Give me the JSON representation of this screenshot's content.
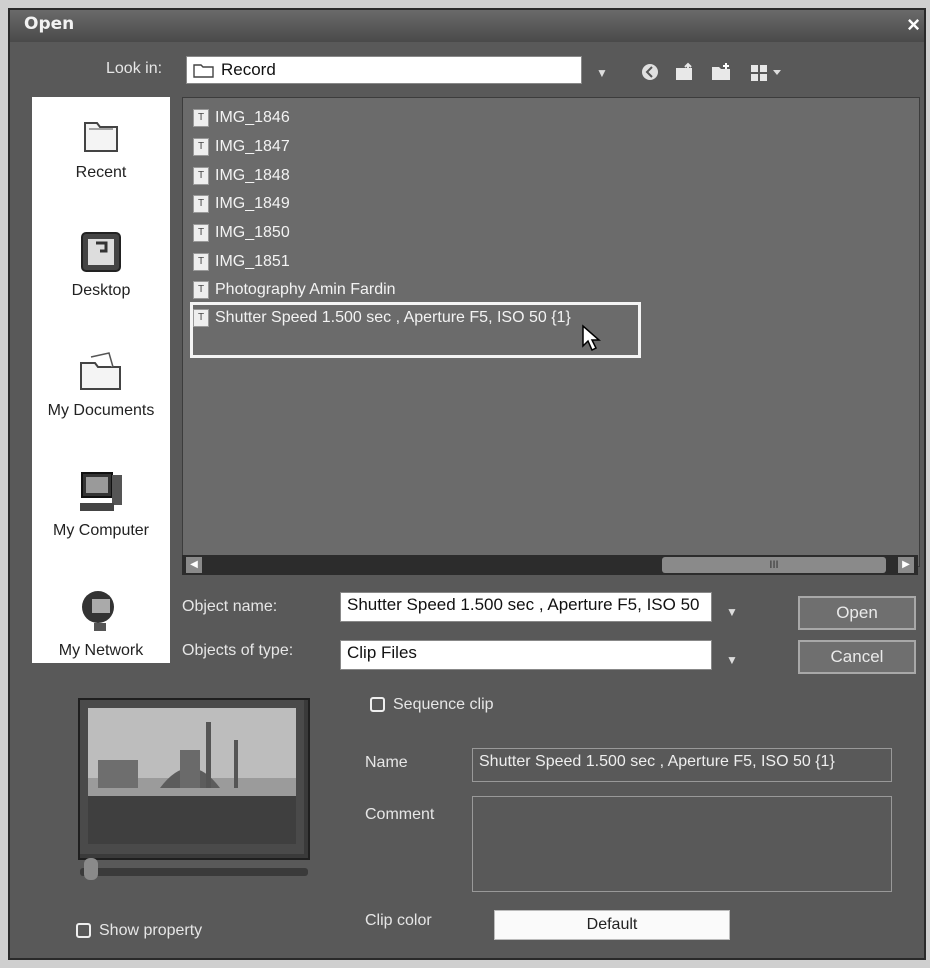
{
  "dialog": {
    "title": "Open",
    "close_glyph": "×"
  },
  "toolbar": {
    "look_in_label": "Look in:",
    "look_in_value": "Record",
    "icons": [
      "back-icon",
      "up-folder-icon",
      "new-folder-icon",
      "view-menu-icon"
    ]
  },
  "places": [
    {
      "label": "Recent",
      "icon": "recent-icon"
    },
    {
      "label": "Desktop",
      "icon": "desktop-icon"
    },
    {
      "label": "My Documents",
      "icon": "my-documents-icon"
    },
    {
      "label": "My Computer",
      "icon": "my-computer-icon"
    },
    {
      "label": "My Network",
      "icon": "my-network-icon"
    }
  ],
  "files": [
    "IMG_1846",
    "IMG_1847",
    "IMG_1848",
    "IMG_1849",
    "IMG_1850",
    "IMG_1851",
    "Photography Amin Fardin",
    "Shutter Speed 1.500 sec , Aperture F5, ISO 50 {1}"
  ],
  "selected_file_index": 7,
  "scrollbar": {
    "thumb_glyph": "III",
    "left_arrow": "◀",
    "right_arrow": "▶"
  },
  "object_name": {
    "label": "Object name:",
    "value": "Shutter Speed 1.500 sec , Aperture F5, ISO 50"
  },
  "object_type": {
    "label": "Objects of type:",
    "value": "Clip Files"
  },
  "buttons": {
    "open": "Open",
    "cancel": "Cancel"
  },
  "sequence_clip": {
    "label": "Sequence clip",
    "checked": false
  },
  "clip_info": {
    "name_label": "Name",
    "name_value": "Shutter Speed 1.500 sec , Aperture F5, ISO 50 {1}",
    "comment_label": "Comment",
    "comment_value": "",
    "color_label": "Clip color",
    "color_value": "Default"
  },
  "show_property": {
    "label": "Show property",
    "checked": false
  }
}
